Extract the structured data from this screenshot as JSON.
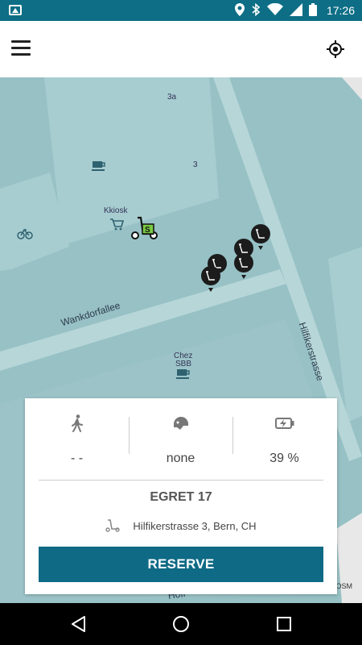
{
  "status_bar": {
    "time": "17:26",
    "icons": [
      "image-icon",
      "location-icon",
      "bluetooth-icon",
      "wifi-icon",
      "signal-icon",
      "battery-icon"
    ]
  },
  "app_bar": {
    "menu_icon": "hamburger-menu-icon",
    "locate_icon": "my-location-icon"
  },
  "map": {
    "labels": {
      "kiosk": "Kkiosk",
      "chez": "Chez",
      "sbb": "SBB",
      "house_3a": "3a",
      "house_3": "3"
    },
    "streets": {
      "wankdorfallee": "Wankdorfallee",
      "hilfikerstrasse": "Hilfikerstrasse",
      "partial": "Hofr"
    },
    "credit": "OSM",
    "colors": {
      "ground": "#97c1c5",
      "block": "#a7cdd1",
      "road": "#b6d6d8",
      "marker": "#1c1c1c",
      "accent": "#7ac943"
    }
  },
  "card": {
    "stats": [
      {
        "icon": "walking-person-icon",
        "value": "- -"
      },
      {
        "icon": "helmet-icon",
        "value": "none"
      },
      {
        "icon": "battery-charging-icon",
        "value": "39 %"
      }
    ],
    "scooter_name": "EGRET 17",
    "address_icon": "scooter-icon",
    "address": "Hilfikerstrasse 3, Bern, CH",
    "reserve_label": "RESERVE",
    "accent": "#0e6a85"
  },
  "nav_bar": {
    "back_icon": "back-triangle-icon",
    "home_icon": "home-circle-icon",
    "recents_icon": "recents-square-icon"
  }
}
